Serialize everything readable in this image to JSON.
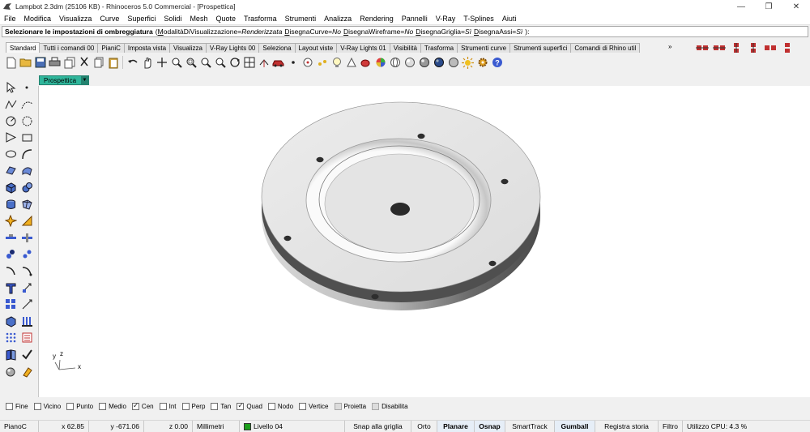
{
  "window": {
    "title": "Lampbot 2.3dm (25106 KB) - Rhinoceros 5.0 Commercial - [Prospettica]",
    "minimize_glyph": "—",
    "restore_glyph": "❐",
    "close_glyph": "✕"
  },
  "menu": [
    "File",
    "Modifica",
    "Visualizza",
    "Curve",
    "Superfici",
    "Solidi",
    "Mesh",
    "Quote",
    "Trasforma",
    "Strumenti",
    "Analizza",
    "Rendering",
    "Pannelli",
    "V-Ray",
    "T-Splines",
    "Aiuti"
  ],
  "command": {
    "prompt": "Selezionare le impostazioni di ombreggiatura",
    "open_paren": "(",
    "close_paren": "):",
    "options": [
      {
        "key": "M",
        "rest": "odalitàDiVisualizzazione=",
        "value": "Renderizzata"
      },
      {
        "key": "D",
        "rest": "isegnaCurve=",
        "value": "No"
      },
      {
        "key": "D",
        "rest": "isegnaWireframe=",
        "value": "No"
      },
      {
        "key": "D",
        "rest": "isegnaGriglia=",
        "value": "Sì"
      },
      {
        "key": "D",
        "rest": "isegnaAssi=",
        "value": "Sì"
      }
    ]
  },
  "tabs": [
    "Standard",
    "Tutti i comandi 00",
    "PianiC",
    "Imposta vista",
    "Visualizza",
    "V-Ray Lights 00",
    "Seleziona",
    "Layout viste",
    "V-Ray Lights 01",
    "Visibilità",
    "Trasforma",
    "Strumenti curve",
    "Strumenti superfici",
    "Comandi di Rhino util"
  ],
  "tab_more": "»",
  "viewport": {
    "label": "Prospettica",
    "arrow": "▼",
    "axis_y": "y",
    "axis_z": "z",
    "axis_x": "x"
  },
  "osnaps": [
    {
      "label": "Fine",
      "checked": false
    },
    {
      "label": "Vicino",
      "checked": false
    },
    {
      "label": "Punto",
      "checked": false
    },
    {
      "label": "Medio",
      "checked": false
    },
    {
      "label": "Cen",
      "checked": true
    },
    {
      "label": "Int",
      "checked": false
    },
    {
      "label": "Perp",
      "checked": false
    },
    {
      "label": "Tan",
      "checked": false
    },
    {
      "label": "Quad",
      "checked": true
    },
    {
      "label": "Nodo",
      "checked": false
    },
    {
      "label": "Vertice",
      "checked": false
    },
    {
      "label": "Proietta",
      "checked": false
    },
    {
      "label": "Disabilita",
      "checked": false
    }
  ],
  "status": {
    "cplane": "PianoC",
    "x": "x 62.85",
    "y": "y -671.06",
    "z": "z 0.00",
    "units": "Millimetri",
    "layer": "Livello 04",
    "grid_snap": "Snap alla griglia",
    "ortho": "Orto",
    "planar": "Planare",
    "osnap": "Osnap",
    "smarttrack": "SmartTrack",
    "gumball": "Gumball",
    "history": "Registra storia",
    "filter": "Filtro",
    "cpu": "Utilizzo CPU: 4.3 %"
  },
  "colors": {
    "viewport_tab": "#2fb69b",
    "layer_swatch": "#1b9e1b"
  },
  "icons": {
    "toolbar": [
      "new-file-icon",
      "open-file-icon",
      "save-icon",
      "print-icon",
      "copy-doc-icon",
      "cut-icon",
      "copy-icon",
      "paste-icon",
      "undo-icon",
      "pan-hand-icon",
      "move-view-icon",
      "zoom-icon",
      "zoom-window-icon",
      "zoom-extents-icon",
      "zoom-selected-icon",
      "rotate-view-icon",
      "four-views-icon",
      "cplane-icon",
      "car-icon",
      "point-icon",
      "light-bulb-icon",
      "render-icon",
      "color-wheel-icon",
      "sphere-shaded-icon",
      "sphere-render-icon",
      "sphere-dark-icon",
      "sun-icon",
      "gear-icon",
      "help-icon"
    ],
    "left": [
      "select-arrow-icon",
      "point-tool-icon",
      "polyline-icon",
      "curve-icon",
      "circle-icon",
      "arc-icon",
      "polygon-icon",
      "rectangle-icon",
      "ellipse-icon",
      "curve-arc-icon",
      "surface-icon",
      "surface-edit-icon",
      "box-solid-icon",
      "solid-sphere-icon",
      "cylinder-icon",
      "mesh-icon",
      "explode-icon",
      "boolean-icon",
      "align-icon",
      "dimension-icon",
      "split-icon",
      "join-icon",
      "fillet-icon",
      "trim-icon",
      "text-icon",
      "extrude-icon",
      "array-icon",
      "transform-icon",
      "box-icon",
      "columns-icon",
      "dots-grid-icon",
      "counter-icon",
      "book-icon",
      "check-icon",
      "shade-icon",
      "paint-icon"
    ],
    "right": [
      "layout-a-icon",
      "layout-b-icon",
      "layout-c-icon",
      "layout-d-icon",
      "layout-e-icon",
      "layout-f-icon"
    ]
  }
}
